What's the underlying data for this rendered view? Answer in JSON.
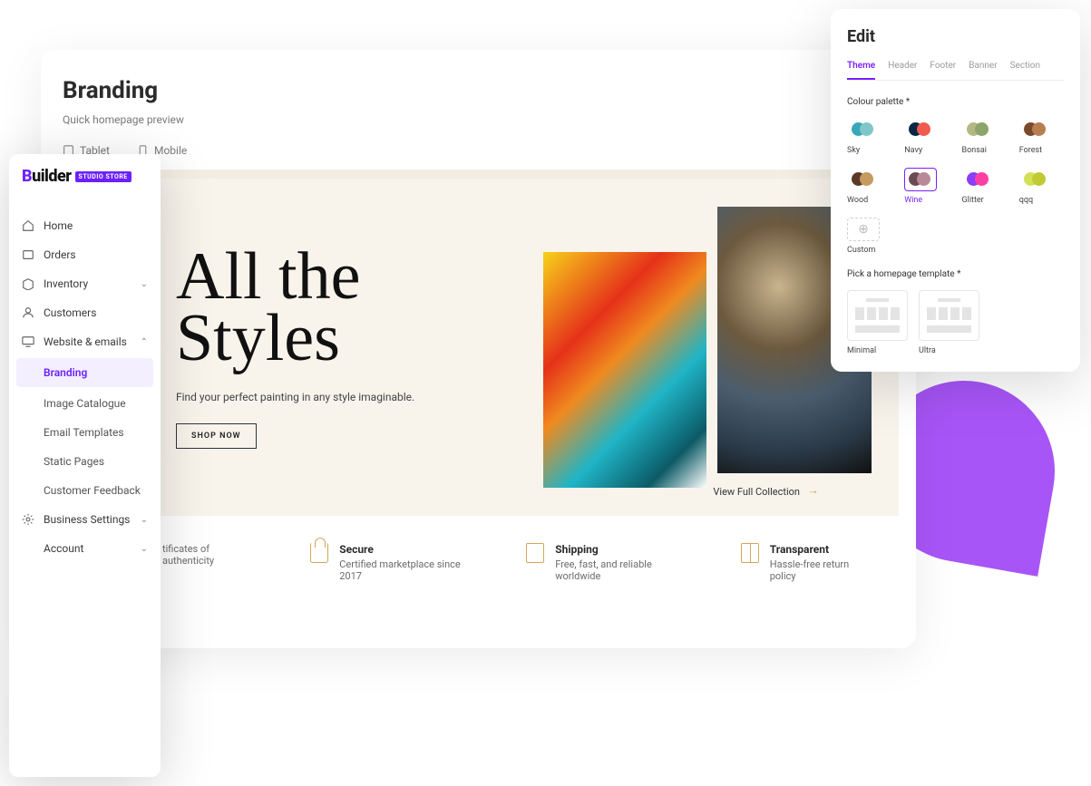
{
  "page": {
    "title": "Branding",
    "subtitle": "Quick homepage preview"
  },
  "devices": {
    "tablet": "Tablet",
    "mobile": "Mobile"
  },
  "hero": {
    "line1": "All the",
    "line2": "Styles",
    "sub": "Find your perfect painting in any style imaginable.",
    "cta": "SHOP NOW",
    "view_full": "View Full Collection"
  },
  "features": [
    {
      "title_partial": "tificates of authenticity",
      "desc": ""
    },
    {
      "title": "Secure",
      "desc": "Certified marketplace since 2017"
    },
    {
      "title": "Shipping",
      "desc": "Free, fast, and reliable worldwide"
    },
    {
      "title": "Transparent",
      "desc": "Hassle-free return policy"
    }
  ],
  "sidebar": {
    "logo_badge": "STUDIO STORE",
    "items": {
      "home": "Home",
      "orders": "Orders",
      "inventory": "Inventory",
      "customers": "Customers",
      "website": "Website & emails",
      "business": "Business Settings",
      "account": "Account"
    },
    "sub": {
      "branding": "Branding",
      "catalogue": "Image Catalogue",
      "email": "Email Templates",
      "static": "Static Pages",
      "feedback": "Customer Feedback"
    }
  },
  "edit": {
    "title": "Edit",
    "tabs": [
      "Theme",
      "Header",
      "Footer",
      "Banner",
      "Section"
    ],
    "colour_label": "Colour palette *",
    "palettes": {
      "sky": "Sky",
      "navy": "Navy",
      "bonsai": "Bonsai",
      "forest": "Forest",
      "wood": "Wood",
      "wine": "Wine",
      "glitter": "Glitter",
      "qqq": "qqq",
      "custom": "Custom"
    },
    "template_label": "Pick a homepage template *",
    "templates": {
      "minimal": "Minimal",
      "ultra": "Ultra"
    }
  },
  "colors": {
    "sky": [
      "#3aa6b9",
      "#7fc6c8"
    ],
    "navy": [
      "#0b2545",
      "#f05a4f"
    ],
    "bonsai": [
      "#b6b884",
      "#8da56b"
    ],
    "forest": [
      "#7a4a2d",
      "#b67f4f"
    ],
    "wood": [
      "#5a3a26",
      "#c79a5f"
    ],
    "wine": [
      "#6b4a57",
      "#b88a97"
    ],
    "glitter": [
      "#8a3ffc",
      "#ff3ea5"
    ],
    "qqq": [
      "#d4e157",
      "#c0ca33"
    ]
  }
}
